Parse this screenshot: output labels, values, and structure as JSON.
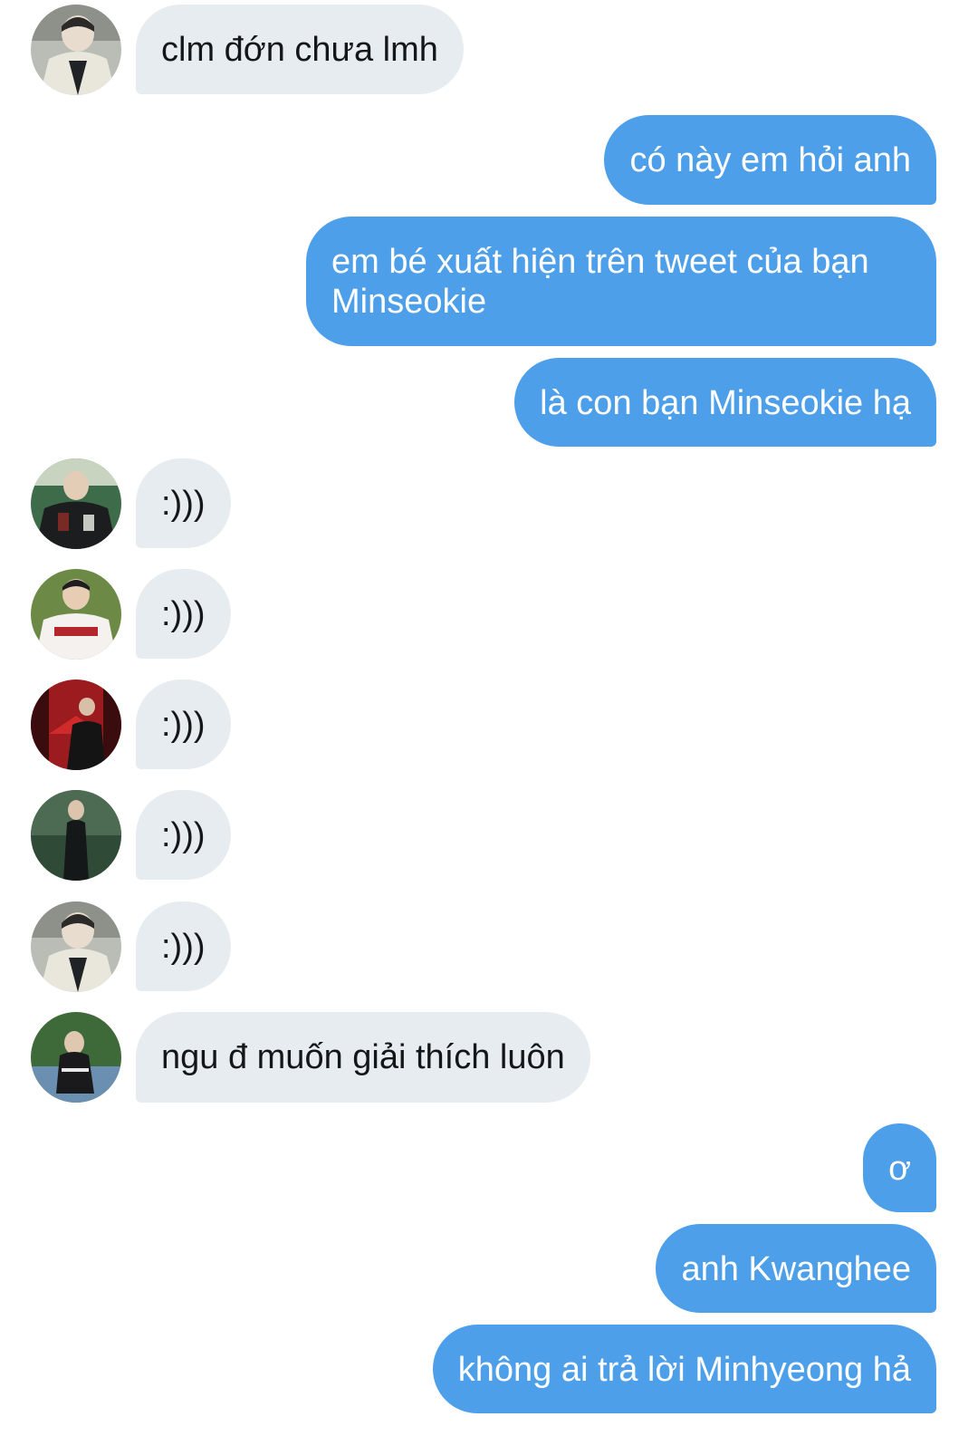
{
  "conversation": {
    "messages": [
      {
        "direction": "incoming",
        "avatar": "avatar-1",
        "text": "clm đớn chưa lmh"
      },
      {
        "direction": "outgoing",
        "text": "có này em hỏi anh"
      },
      {
        "direction": "outgoing",
        "text": "em bé xuất hiện trên tweet của bạn Minseokie"
      },
      {
        "direction": "outgoing",
        "text": "là con bạn Minseokie hạ"
      },
      {
        "direction": "incoming",
        "avatar": "avatar-2",
        "text": ":)))"
      },
      {
        "direction": "incoming",
        "avatar": "avatar-3",
        "text": ":)))"
      },
      {
        "direction": "incoming",
        "avatar": "avatar-4",
        "text": ":)))"
      },
      {
        "direction": "incoming",
        "avatar": "avatar-5",
        "text": ":)))"
      },
      {
        "direction": "incoming",
        "avatar": "avatar-1",
        "text": ":)))"
      },
      {
        "direction": "incoming",
        "avatar": "avatar-6",
        "text": "ngu đ muốn giải thích luôn"
      },
      {
        "direction": "outgoing",
        "text": "ơ"
      },
      {
        "direction": "outgoing",
        "text": "anh Kwanghee"
      },
      {
        "direction": "outgoing",
        "text": "không ai trả lời Minhyeong hả"
      }
    ]
  },
  "colors": {
    "incoming_bubble": "#e6ecf0",
    "outgoing_bubble": "#4d9fea",
    "incoming_text": "#14171a",
    "outgoing_text": "#ffffff"
  }
}
